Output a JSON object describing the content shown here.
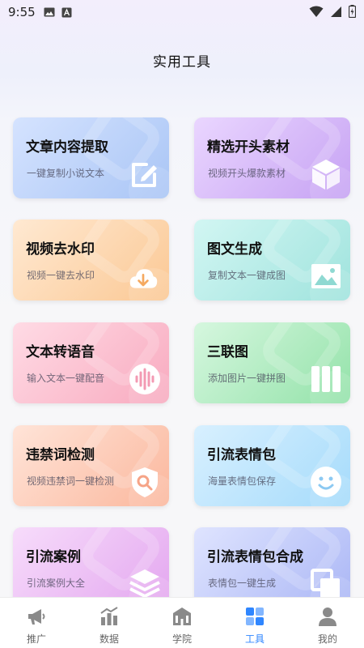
{
  "status_bar": {
    "time": "9:55",
    "left_icons": [
      "image-icon",
      "a-badge-icon"
    ],
    "right_icons": [
      "wifi-icon",
      "signal-icon",
      "battery-icon"
    ]
  },
  "page": {
    "title": "实用工具"
  },
  "tools": [
    {
      "title": "文章内容提取",
      "subtitle": "一键复制小说文本",
      "icon": "edit-icon"
    },
    {
      "title": "精选开头素材",
      "subtitle": "视频开头爆款素材",
      "icon": "cube-icon"
    },
    {
      "title": "视频去水印",
      "subtitle": "视频一键去水印",
      "icon": "cloud-download-icon"
    },
    {
      "title": "图文生成",
      "subtitle": "复制文本一键成图",
      "icon": "image-icon"
    },
    {
      "title": "文本转语音",
      "subtitle": "输入文本一键配音",
      "icon": "sound-wave-icon"
    },
    {
      "title": "三联图",
      "subtitle": "添加图片一键拼图",
      "icon": "three-panel-icon"
    },
    {
      "title": "违禁词检测",
      "subtitle": "视频违禁词一键检测",
      "icon": "shield-search-icon"
    },
    {
      "title": "引流表情包",
      "subtitle": "海量表情包保存",
      "icon": "smiley-icon"
    },
    {
      "title": "引流案例",
      "subtitle": "引流案例大全",
      "icon": "layers-icon"
    },
    {
      "title": "引流表情包合成",
      "subtitle": "表情包一键生成",
      "icon": "copy-frames-icon"
    }
  ],
  "tab_bar": {
    "active_index": 3,
    "active_color": "#2f86ff",
    "items": [
      {
        "label": "推广",
        "icon": "megaphone-icon"
      },
      {
        "label": "数据",
        "icon": "bar-chart-icon"
      },
      {
        "label": "学院",
        "icon": "building-icon"
      },
      {
        "label": "工具",
        "icon": "tools-grid-icon"
      },
      {
        "label": "我的",
        "icon": "user-icon"
      }
    ]
  }
}
